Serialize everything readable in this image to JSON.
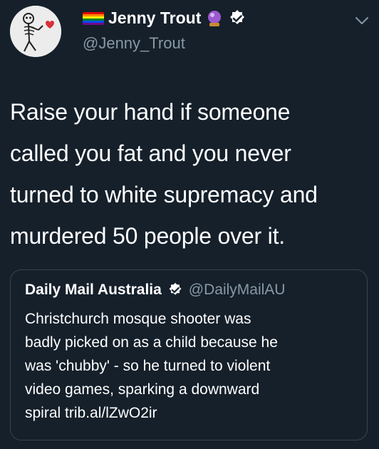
{
  "tweet": {
    "author_name": "Jenny Trout",
    "author_handle": "@Jenny_Trout",
    "text_lines": [
      "Raise your hand if someone",
      "called you fat and you never",
      "turned to white supremacy and",
      "murdered 50 people over it."
    ],
    "icons": [
      "rainbow-flag-icon",
      "crystal-ball-icon",
      "verified-badge-icon",
      "chevron-down-icon"
    ]
  },
  "quoted_tweet": {
    "author_name": "Daily Mail Australia",
    "author_handle": "@DailyMailAU",
    "text_lines": [
      "Christchurch mosque shooter was",
      "badly picked on as a child because he",
      "was 'chubby' - so he turned to violent",
      "video games, sparking a downward"
    ],
    "last_line_prefix": "spiral ",
    "link": "trib.al/lZwO2ir"
  },
  "colors": {
    "background": "#15202b",
    "secondary_text": "#8899a6",
    "border": "#38444d",
    "verified": "#ffffff"
  }
}
